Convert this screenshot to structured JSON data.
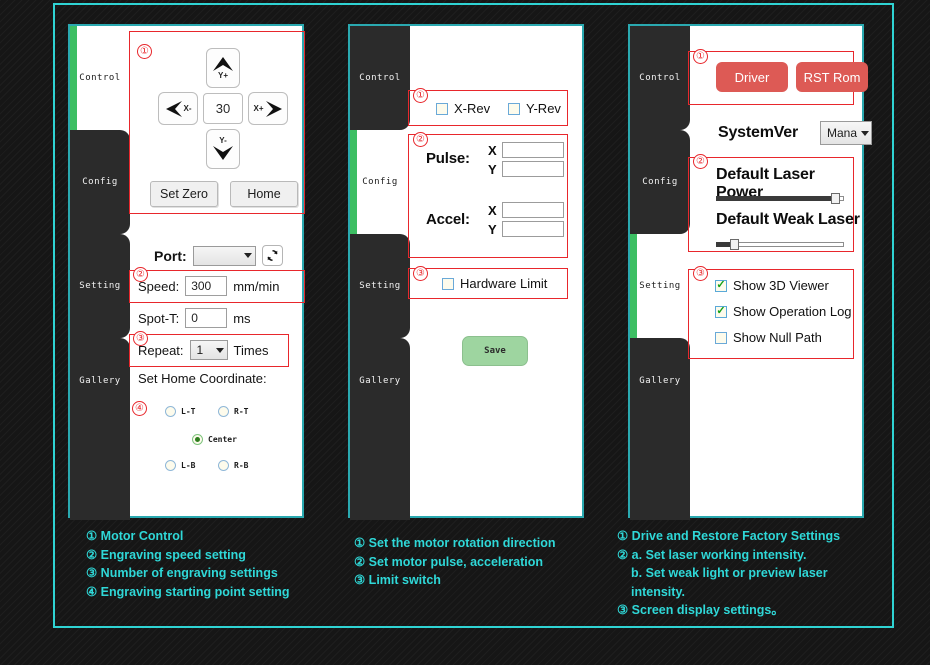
{
  "theme": {
    "accent_teal": "#2fd3d3",
    "marker_red": "#e8272c",
    "tab_active_green": "#3dbf63",
    "button_red": "#dd5a55",
    "save_green": "#9ed5a0"
  },
  "sidebar": {
    "items": [
      {
        "label": "Control"
      },
      {
        "label": "Config"
      },
      {
        "label": "Setting"
      },
      {
        "label": "Gallery"
      }
    ]
  },
  "panel1": {
    "active_tab": "Control",
    "markers": [
      "①",
      "②",
      "③",
      "④"
    ],
    "jog": {
      "up_label": "Y+",
      "down_label": "Y-",
      "left_label": "X-",
      "right_label": "X+",
      "step_value": "30"
    },
    "set_zero_label": "Set Zero",
    "home_label": "Home",
    "port_label": "Port:",
    "port_value": "",
    "refresh_icon": "refresh-icon",
    "speed_label": "Speed:",
    "speed_value": "300",
    "speed_unit": "mm/min",
    "spot_label": "Spot-T:",
    "spot_value": "0",
    "spot_unit": "ms",
    "repeat_label": "Repeat:",
    "repeat_value": "1",
    "repeat_unit": "Times",
    "home_coord_label": "Set Home Coordinate:",
    "origins": [
      {
        "label": "L-T",
        "selected": false
      },
      {
        "label": "R-T",
        "selected": false
      },
      {
        "label": "Center",
        "selected": true
      },
      {
        "label": "L-B",
        "selected": false
      },
      {
        "label": "R-B",
        "selected": false
      }
    ]
  },
  "panel2": {
    "active_tab": "Config",
    "markers": [
      "①",
      "②",
      "③"
    ],
    "x_rev_label": "X-Rev",
    "x_rev_checked": false,
    "y_rev_label": "Y-Rev",
    "y_rev_checked": false,
    "pulse_label": "Pulse:",
    "accel_label": "Accel:",
    "axis_x": "X",
    "axis_y": "Y",
    "pulse_x_value": "",
    "pulse_y_value": "",
    "accel_x_value": "",
    "accel_y_value": "",
    "hardware_limit_label": "Hardware Limit",
    "hardware_limit_checked": false,
    "save_label": "Save"
  },
  "panel3": {
    "active_tab": "Setting",
    "markers": [
      "①",
      "②",
      "③"
    ],
    "driver_label": "Driver",
    "rst_rom_label": "RST Rom",
    "systemver_label": "SystemVer",
    "systemver_value": "Mana",
    "default_laser_power_label": "Default Laser Power",
    "default_laser_power_pct": 97,
    "default_weak_laser_label": "Default Weak Laser",
    "default_weak_laser_pct": 12,
    "checkboxes": [
      {
        "label": "Show 3D Viewer",
        "checked": true
      },
      {
        "label": "Show Operation Log",
        "checked": true
      },
      {
        "label": "Show Null Path",
        "checked": false
      }
    ]
  },
  "captions": {
    "col1": [
      "① Motor Control",
      "② Engraving speed setting",
      "③ Number of engraving settings",
      "④ Engraving starting point setting"
    ],
    "col2": [
      "① Set the motor rotation direction",
      "② Set motor pulse, acceleration",
      "③ Limit switch"
    ],
    "col3": [
      "① Drive and Restore Factory Settings",
      "② a. Set laser working intensity.",
      "b. Set weak light or preview laser",
      "intensity.",
      "③ Screen display settings。"
    ]
  }
}
